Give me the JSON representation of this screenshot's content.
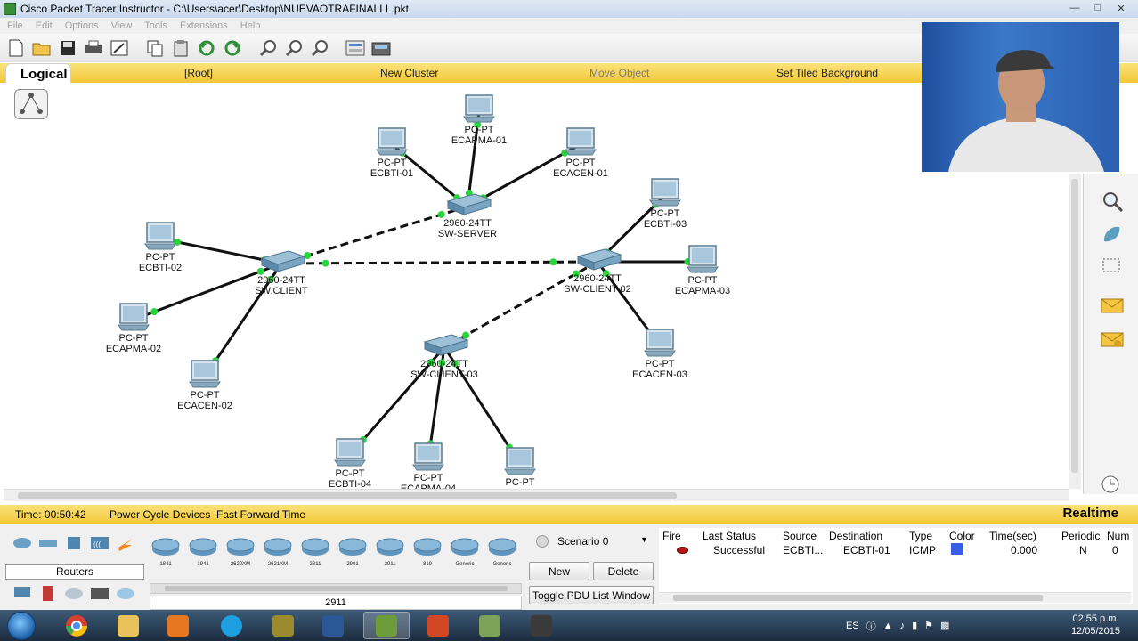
{
  "window": {
    "title": "Cisco Packet Tracer Instructor - C:\\Users\\acer\\Desktop\\NUEVAOTRAFINALLL.pkt"
  },
  "menu": [
    "File",
    "Edit",
    "Options",
    "View",
    "Tools",
    "Extensions",
    "Help"
  ],
  "logical_bar": {
    "tab": "Logical",
    "root": "[Root]",
    "new_cluster": "New Cluster",
    "move_object": "Move Object",
    "tiled_background": "Set Tiled Background"
  },
  "network": {
    "devices": [
      {
        "id": "sw-server",
        "model": "2960-24TT",
        "name": "SW-SERVER",
        "kind": "switch"
      },
      {
        "id": "sw-client",
        "model": "2960-24TT",
        "name": "SW.CLIENT",
        "kind": "switch"
      },
      {
        "id": "sw-client-02",
        "model": "2960-24TT",
        "name": "SW-CLIENT 02",
        "kind": "switch"
      },
      {
        "id": "sw-client-03",
        "model": "2960-24TT",
        "name": "SW-CLIENT-03",
        "kind": "switch"
      },
      {
        "id": "ecapma-01",
        "model": "PC-PT",
        "name": "ECAPMA-01",
        "kind": "pc"
      },
      {
        "id": "ecbti-01",
        "model": "PC-PT",
        "name": "ECBTI-01",
        "kind": "pc"
      },
      {
        "id": "ecacen-01",
        "model": "PC-PT",
        "name": "ECACEN-01",
        "kind": "pc"
      },
      {
        "id": "ecbti-02",
        "model": "PC-PT",
        "name": "ECBTI-02",
        "kind": "pc"
      },
      {
        "id": "ecapma-02",
        "model": "PC-PT",
        "name": "ECAPMA-02",
        "kind": "pc"
      },
      {
        "id": "ecacen-02",
        "model": "PC-PT",
        "name": "ECACEN-02",
        "kind": "pc"
      },
      {
        "id": "ecbti-03",
        "model": "PC-PT",
        "name": "ECBTI-03",
        "kind": "pc"
      },
      {
        "id": "ecapma-03",
        "model": "PC-PT",
        "name": "ECAPMA-03",
        "kind": "pc"
      },
      {
        "id": "ecacen-03",
        "model": "PC-PT",
        "name": "ECACEN-03",
        "kind": "pc"
      },
      {
        "id": "ecbti-04",
        "model": "PC-PT",
        "name": "ECBTI-04",
        "kind": "pc"
      },
      {
        "id": "ecapma-04",
        "model": "PC-PT",
        "name": "ECAPMA-04",
        "kind": "pc"
      },
      {
        "id": "ecacen-04",
        "model": "PC-PT",
        "name": "",
        "kind": "pc"
      }
    ],
    "links": [
      {
        "from": "sw-server",
        "to": "ecapma-01",
        "style": "solid"
      },
      {
        "from": "sw-server",
        "to": "ecbti-01",
        "style": "solid"
      },
      {
        "from": "sw-server",
        "to": "ecacen-01",
        "style": "solid"
      },
      {
        "from": "sw-server",
        "to": "sw-client",
        "style": "dashed"
      },
      {
        "from": "sw-client",
        "to": "sw-client-02",
        "style": "dashed"
      },
      {
        "from": "sw-client-02",
        "to": "sw-client-03",
        "style": "dashed"
      },
      {
        "from": "sw-client",
        "to": "ecbti-02",
        "style": "solid"
      },
      {
        "from": "sw-client",
        "to": "ecapma-02",
        "style": "solid"
      },
      {
        "from": "sw-client",
        "to": "ecacen-02",
        "style": "solid"
      },
      {
        "from": "sw-client-02",
        "to": "ecbti-03",
        "style": "solid"
      },
      {
        "from": "sw-client-02",
        "to": "ecapma-03",
        "style": "solid"
      },
      {
        "from": "sw-client-02",
        "to": "ecacen-03",
        "style": "solid"
      },
      {
        "from": "sw-client-03",
        "to": "ecbti-04",
        "style": "solid"
      },
      {
        "from": "sw-client-03",
        "to": "ecapma-04",
        "style": "solid"
      },
      {
        "from": "sw-client-03",
        "to": "ecacen-04",
        "style": "solid"
      }
    ]
  },
  "realtime_bar": {
    "time": "Time: 00:50:42",
    "power_cycle": "Power Cycle Devices",
    "fast_forward": "Fast Forward Time",
    "mode": "Realtime"
  },
  "device_panel": {
    "category_label": "Routers",
    "devices": [
      "1841",
      "1941",
      "2620XM",
      "2621XM",
      "2811",
      "2901",
      "2911",
      "819",
      "Generic",
      "Generic"
    ],
    "selected_name": "2911"
  },
  "scenario": {
    "selected": "Scenario 0",
    "new_label": "New",
    "delete_label": "Delete",
    "toggle_label": "Toggle PDU List Window"
  },
  "pdu_table": {
    "headers": [
      "Fire",
      "Last Status",
      "Source",
      "Destination",
      "Type",
      "Color",
      "Time(sec)",
      "Periodic",
      "Num"
    ],
    "rows": [
      {
        "last_status": "Successful",
        "source": "ECBTI...",
        "destination": "ECBTI-01",
        "type": "ICMP",
        "color": "#3b5ee8",
        "time": "0.000",
        "periodic": "N",
        "num": "0"
      }
    ]
  },
  "taskbar": {
    "language": "ES",
    "time": "02:55 p.m.",
    "date": "12/05/2015"
  },
  "colors": {
    "yellow_bar": "#f2c736",
    "link_dot": "#27d63a",
    "link": "#111111"
  }
}
